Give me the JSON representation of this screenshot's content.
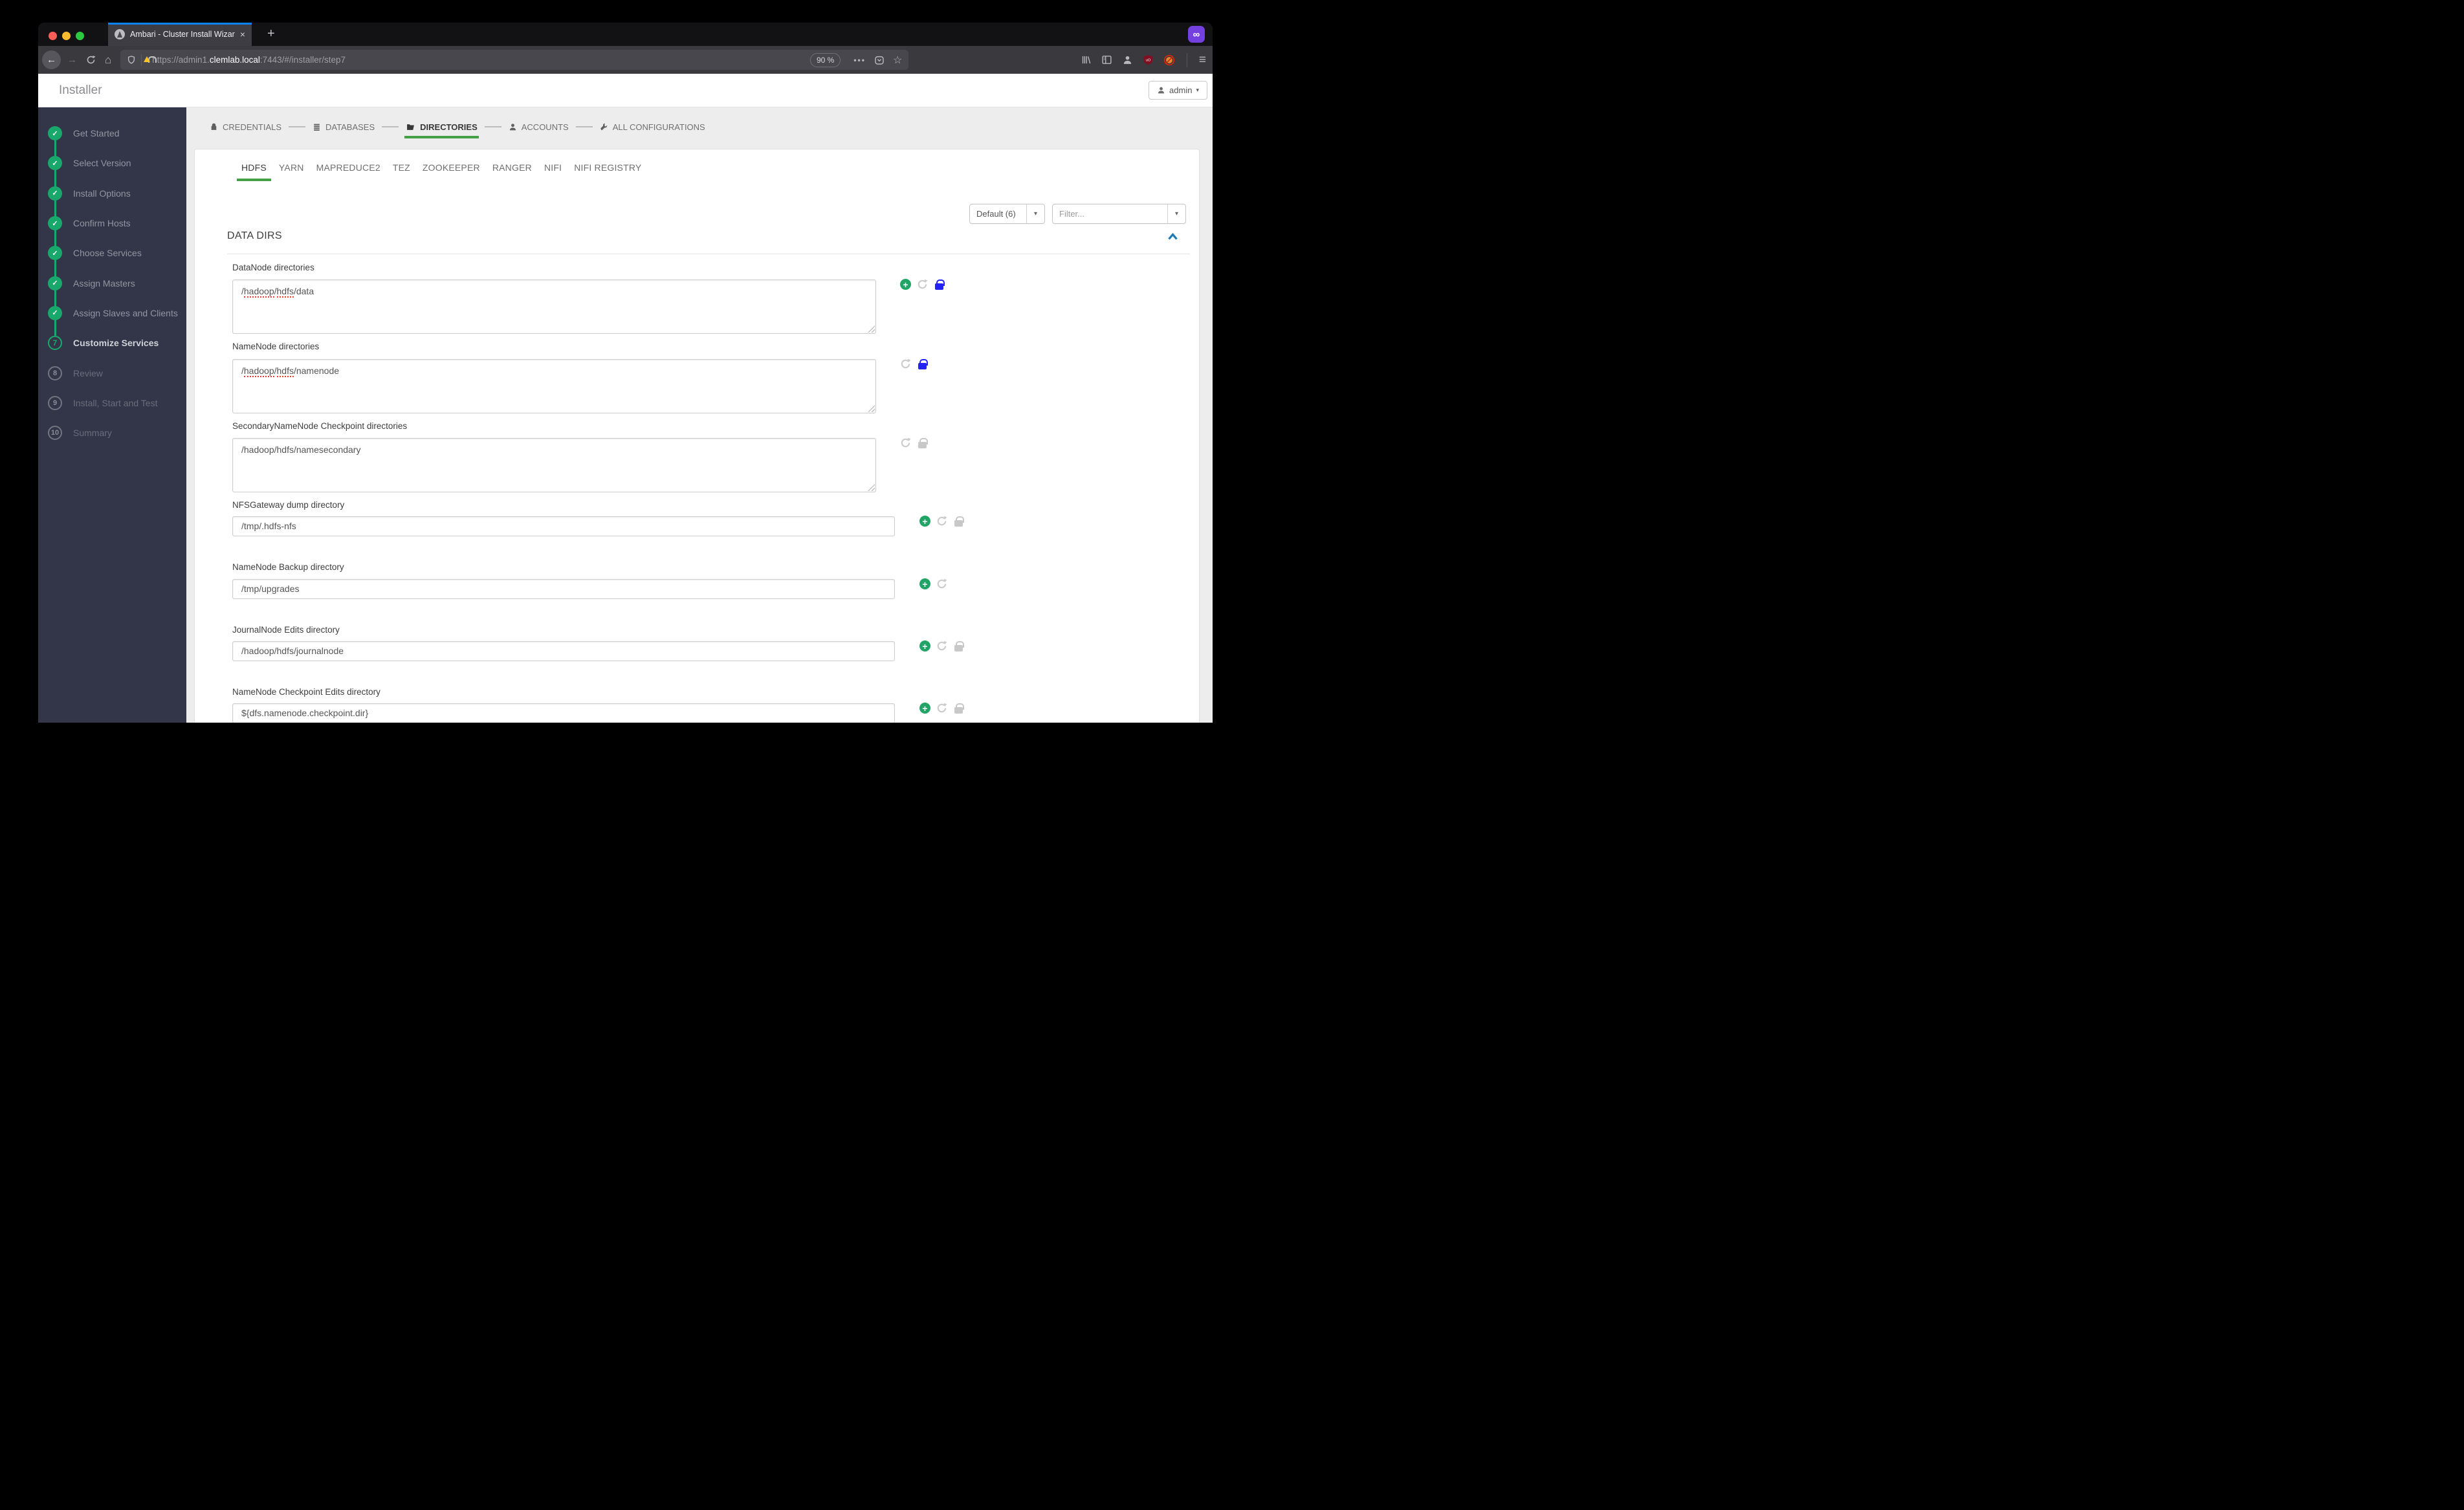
{
  "browser": {
    "tab_title": "Ambari - Cluster Install Wizard",
    "url": {
      "prefix": "https://admin1.",
      "domain": "clemlab.local",
      "suffix": ":7443/#/installer/step7"
    },
    "zoom_level": "90 %"
  },
  "icons": {
    "back": "←",
    "forward": "→",
    "home": "⌂",
    "menu": "≡",
    "more": "•••",
    "bookmark": "☆",
    "new_tab": "+",
    "close_tab": "×",
    "mask": "∞",
    "caret_down": "▾",
    "check": "✓",
    "plus": "+",
    "collapse": "^"
  },
  "app": {
    "header_title": "Installer",
    "user_menu_label": "admin"
  },
  "sidebar": {
    "steps": [
      {
        "label": "Get Started",
        "status": "done"
      },
      {
        "label": "Select Version",
        "status": "done"
      },
      {
        "label": "Install Options",
        "status": "done"
      },
      {
        "label": "Confirm Hosts",
        "status": "done"
      },
      {
        "label": "Choose Services",
        "status": "done"
      },
      {
        "label": "Assign Masters",
        "status": "done"
      },
      {
        "label": "Assign Slaves and Clients",
        "status": "done"
      },
      {
        "label": "Customize Services",
        "status": "current",
        "number": "7"
      },
      {
        "label": "Review",
        "status": "upcoming",
        "number": "8"
      },
      {
        "label": "Install, Start and Test",
        "status": "upcoming",
        "number": "9"
      },
      {
        "label": "Summary",
        "status": "upcoming",
        "number": "10"
      }
    ]
  },
  "breadcrumb": {
    "items": [
      {
        "label": "CREDENTIALS",
        "icon": "lock-icon",
        "active": false
      },
      {
        "label": "DATABASES",
        "icon": "database-icon",
        "active": false
      },
      {
        "label": "DIRECTORIES",
        "icon": "folder-icon",
        "active": true
      },
      {
        "label": "ACCOUNTS",
        "icon": "person-icon",
        "active": false
      },
      {
        "label": "ALL CONFIGURATIONS",
        "icon": "wrench-icon",
        "active": false
      }
    ]
  },
  "service_tabs": [
    {
      "label": "HDFS",
      "active": true
    },
    {
      "label": "YARN",
      "active": false
    },
    {
      "label": "MAPREDUCE2",
      "active": false
    },
    {
      "label": "TEZ",
      "active": false
    },
    {
      "label": "ZOOKEEPER",
      "active": false
    },
    {
      "label": "RANGER",
      "active": false
    },
    {
      "label": "NIFI",
      "active": false
    },
    {
      "label": "NIFI REGISTRY",
      "active": false
    }
  ],
  "config_toolbar": {
    "group_select_value": "Default (6)",
    "filter_placeholder": "Filter..."
  },
  "section": {
    "title": "DATA DIRS"
  },
  "fields": [
    {
      "label": "DataNode directories",
      "value": "/hadoop/hdfs/data",
      "kind": "textarea",
      "icons": [
        "add",
        "undo",
        "lock-final"
      ],
      "misspelled": [
        "hadoop",
        "hdfs"
      ]
    },
    {
      "label": "NameNode directories",
      "value": "/hadoop/hdfs/namenode",
      "kind": "textarea",
      "icons": [
        "undo",
        "lock-final"
      ],
      "misspelled": [
        "hadoop",
        "hdfs"
      ]
    },
    {
      "label": "SecondaryNameNode Checkpoint directories",
      "value": "/hadoop/hdfs/namesecondary",
      "kind": "textarea",
      "icons": [
        "undo",
        "lock"
      ],
      "misspelled": []
    },
    {
      "label": "NFSGateway dump directory",
      "value": "/tmp/.hdfs-nfs",
      "kind": "input",
      "icons": [
        "add",
        "undo",
        "lock"
      ],
      "misspelled": []
    },
    {
      "label": "NameNode Backup directory",
      "value": "/tmp/upgrades",
      "kind": "input",
      "icons": [
        "add",
        "undo"
      ],
      "misspelled": []
    },
    {
      "label": "JournalNode Edits directory",
      "value": "/hadoop/hdfs/journalnode",
      "kind": "input",
      "icons": [
        "add",
        "undo",
        "lock"
      ],
      "misspelled": []
    },
    {
      "label": "NameNode Checkpoint Edits directory",
      "value": "${dfs.namenode.checkpoint.dir}",
      "kind": "input",
      "icons": [
        "add",
        "undo",
        "lock"
      ],
      "misspelled": []
    }
  ],
  "colors": {
    "accent_green": "#43a047",
    "step_done_green": "#19a86b",
    "add_green": "#20a566",
    "final_lock_blue": "#2222f2",
    "tab_accent_blue": "#0a84ff",
    "collapse_blue": "#1a7bb5",
    "private_badge_purple": "#7440e0"
  }
}
